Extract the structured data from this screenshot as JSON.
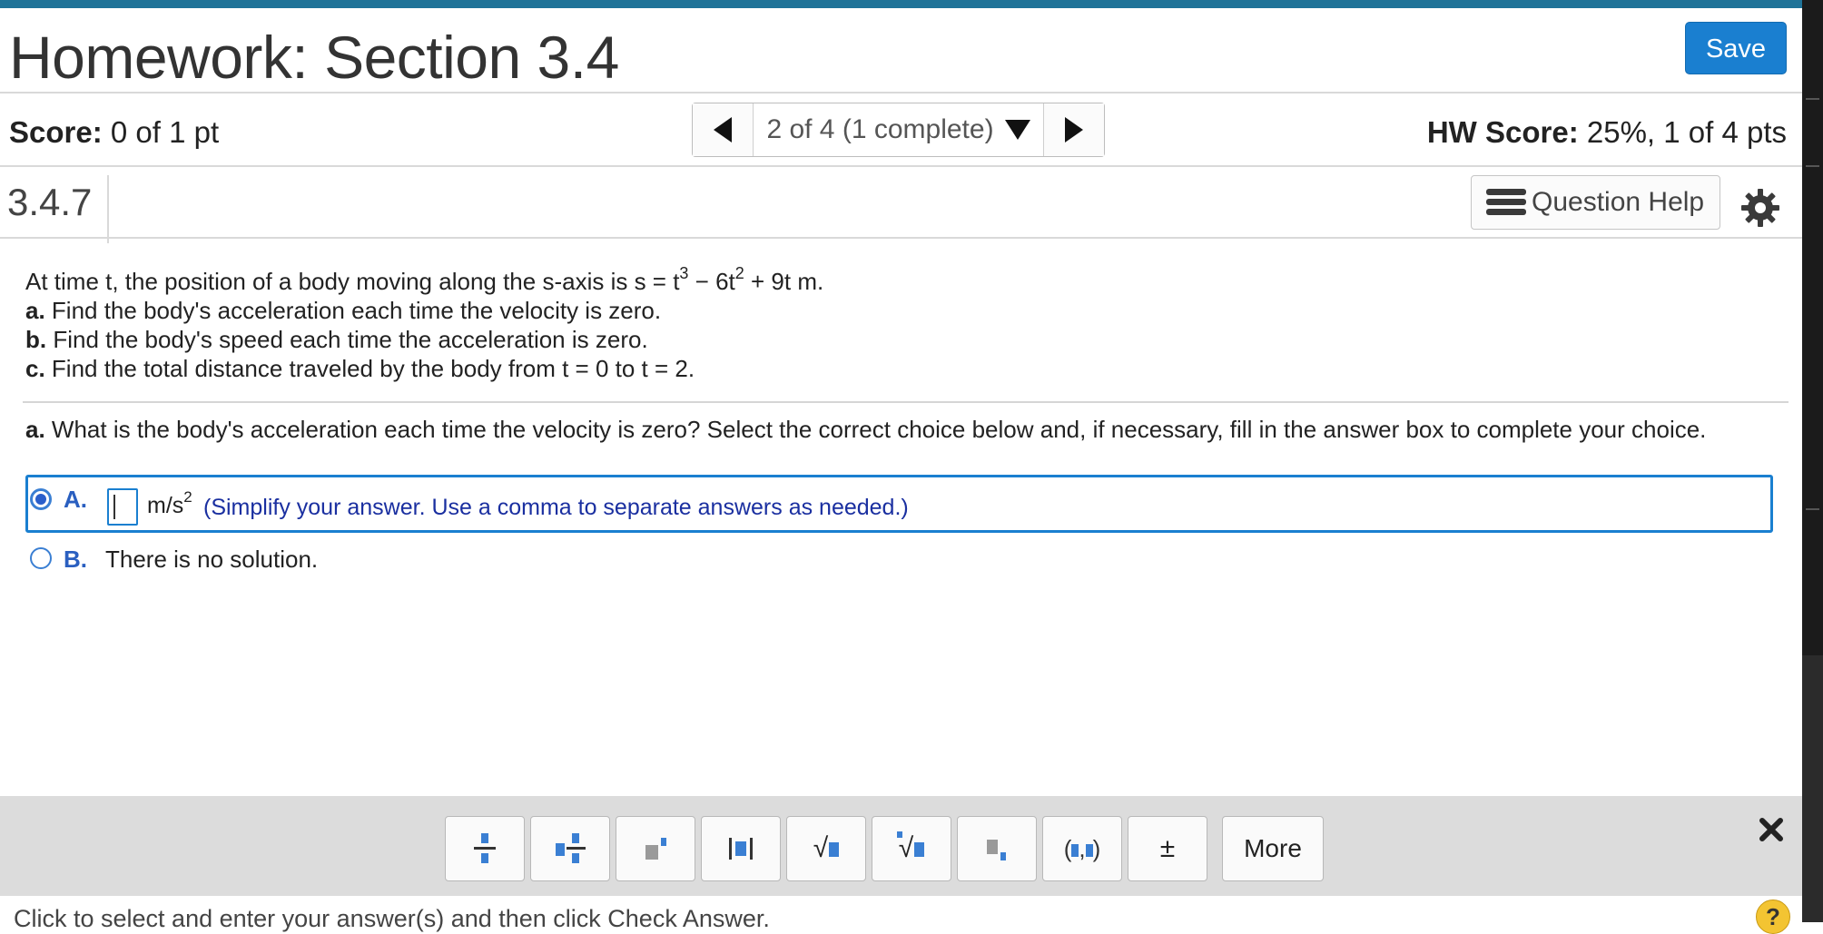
{
  "header": {
    "title": "Homework: Section 3.4",
    "save_label": "Save"
  },
  "status": {
    "score_label": "Score:",
    "score_value": "0 of 1 pt",
    "nav_counter": "2 of 4 (1 complete)",
    "hw_score_label": "HW Score:",
    "hw_score_value": "25%, 1 of 4 pts"
  },
  "question_bar": {
    "number": "3.4.7",
    "help_label": "Question Help"
  },
  "problem": {
    "intro_prefix": "At time t, the position of a body moving along the s-axis is s = t",
    "exp1": "3",
    "intro_mid": " − 6t",
    "exp2": "2",
    "intro_suffix": " + 9t m.",
    "parts": [
      {
        "label": "a.",
        "text": " Find the body's acceleration each time the velocity is zero."
      },
      {
        "label": "b.",
        "text": " Find the body's speed each time the acceleration is zero."
      },
      {
        "label": "c.",
        "text": " Find the total distance traveled by the body from t = 0 to t = 2."
      }
    ]
  },
  "question": {
    "label": "a.",
    "text": " What is the body's acceleration each time the velocity is zero? Select the correct choice below and, if necessary, fill in the answer box to complete your choice."
  },
  "choices": {
    "a": {
      "letter": "A.",
      "answer_value": "",
      "unit_base": "m/s",
      "unit_exp": "2",
      "hint": "(Simplify your answer. Use a comma to separate answers as needed.)",
      "selected": true
    },
    "b": {
      "letter": "B.",
      "text": "There is no solution.",
      "selected": false
    }
  },
  "toolbar": {
    "tools": [
      {
        "name": "fraction-icon",
        "symbol": ""
      },
      {
        "name": "mixed-number-icon",
        "symbol": ""
      },
      {
        "name": "exponent-icon",
        "symbol": ""
      },
      {
        "name": "absolute-value-icon",
        "symbol": ""
      },
      {
        "name": "square-root-icon",
        "symbol": "√"
      },
      {
        "name": "nth-root-icon",
        "symbol": "√"
      },
      {
        "name": "subscript-icon",
        "symbol": ""
      },
      {
        "name": "ordered-pair-icon",
        "symbol": "( , )"
      },
      {
        "name": "plus-minus-icon",
        "symbol": "±"
      }
    ],
    "more_label": "More"
  },
  "footer": {
    "instruction": "Click to select and enter your answer(s) and then click Check Answer.",
    "help_symbol": "?"
  },
  "colors": {
    "accent": "#1a7fd0",
    "top_bar": "#1f7398",
    "choice_letter": "#2a5fc0",
    "hint": "#1a2fa0",
    "toolbar_bg": "#dcdcdc",
    "help_circle": "#f3c432"
  }
}
